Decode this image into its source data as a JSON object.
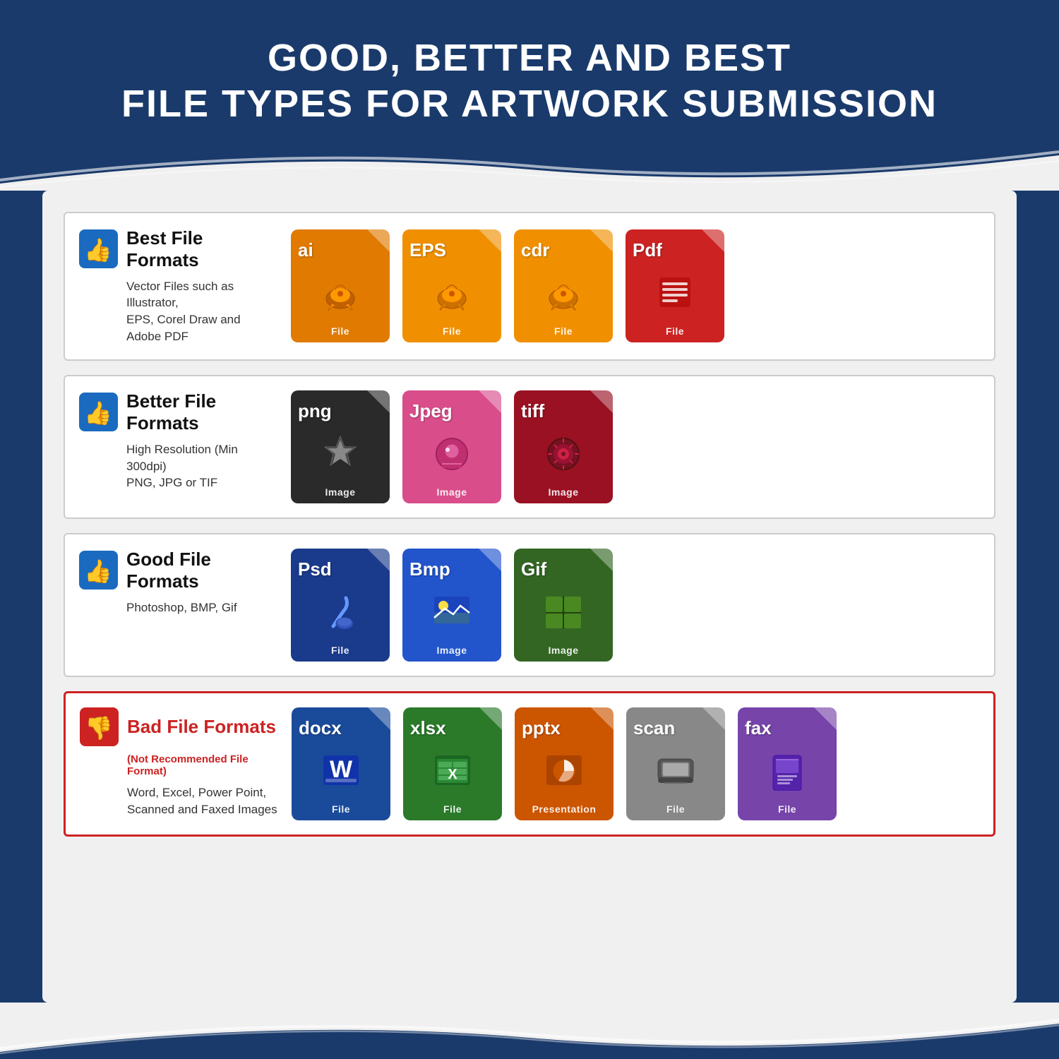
{
  "header": {
    "line1": "GOOD, BETTER AND BEST",
    "line2": "FILE TYPES FOR ARTWORK SUBMISSION"
  },
  "sections": [
    {
      "id": "best",
      "thumb": "thumbs-up",
      "title": "Best File Formats",
      "subtitle": null,
      "desc": "Vector Files such as Illustrator,\nEPS, Corel Draw and Adobe PDF",
      "border_color": "#cccccc",
      "files": [
        {
          "ext": "ai",
          "color": "orange-dark",
          "sub": "File",
          "icon": "vector"
        },
        {
          "ext": "EPS",
          "color": "orange-mid",
          "sub": "File",
          "icon": "vector"
        },
        {
          "ext": "cdr",
          "color": "orange-mid",
          "sub": "File",
          "icon": "vector"
        },
        {
          "ext": "Pdf",
          "color": "red-file",
          "sub": "File",
          "icon": "pdf"
        }
      ]
    },
    {
      "id": "better",
      "thumb": "thumbs-up",
      "title": "Better File Formats",
      "subtitle": null,
      "desc": "High Resolution (Min 300dpi)\nPNG, JPG or TIF",
      "border_color": "#cccccc",
      "files": [
        {
          "ext": "png",
          "color": "dark-gray",
          "sub": "Image",
          "icon": "star"
        },
        {
          "ext": "Jpeg",
          "color": "pink",
          "sub": "Image",
          "icon": "camera"
        },
        {
          "ext": "tiff",
          "color": "dark-red",
          "sub": "Image",
          "icon": "flower"
        }
      ]
    },
    {
      "id": "good",
      "thumb": "thumbs-up",
      "title": "Good File Formats",
      "subtitle": null,
      "desc": "Photoshop, BMP, Gif",
      "border_color": "#cccccc",
      "files": [
        {
          "ext": "Psd",
          "color": "navy",
          "sub": "File",
          "icon": "brush"
        },
        {
          "ext": "Bmp",
          "color": "blue-mid",
          "sub": "Image",
          "icon": "landscape"
        },
        {
          "ext": "Gif",
          "color": "green-dark",
          "sub": "Image",
          "icon": "grid"
        }
      ]
    },
    {
      "id": "bad",
      "thumb": "thumbs-down",
      "title": "Bad File Formats",
      "subtitle": "(Not Recommended File Format)",
      "desc": "Word, Excel, Power Point,\nScanned and Faxed Images",
      "border_color": "#cc2222",
      "files": [
        {
          "ext": "docx",
          "color": "blue-word",
          "sub": "File",
          "icon": "word"
        },
        {
          "ext": "xlsx",
          "color": "green-excel",
          "sub": "File",
          "icon": "excel"
        },
        {
          "ext": "pptx",
          "color": "orange-ppt",
          "sub": "Presentation",
          "icon": "ppt"
        },
        {
          "ext": "scan",
          "color": "gray-scan",
          "sub": "File",
          "icon": "scanner"
        },
        {
          "ext": "fax",
          "color": "purple-fax",
          "sub": "File",
          "icon": "fax"
        }
      ]
    }
  ]
}
